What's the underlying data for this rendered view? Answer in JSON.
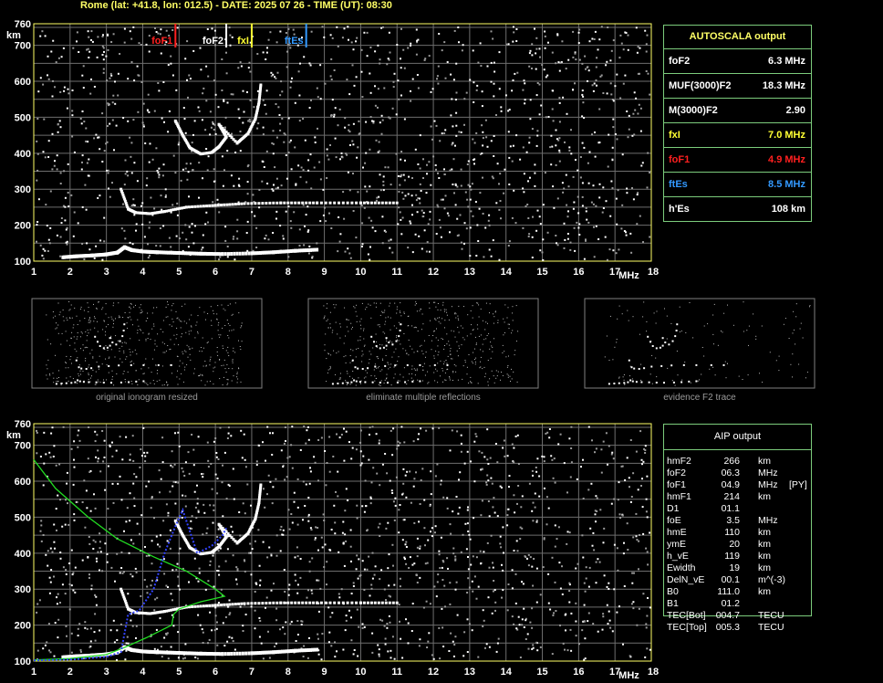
{
  "header": {
    "title": "Rome (lat: +41.8, lon: 012.5) - DATE: 2025 07 26 - TIME (UT): 08:30"
  },
  "axis": {
    "x_unit": "MHz",
    "y_unit": "km",
    "x_ticks": [
      "1",
      "2",
      "3",
      "4",
      "5",
      "6",
      "7",
      "8",
      "9",
      "10",
      "11",
      "12",
      "13",
      "14",
      "15",
      "16",
      "17",
      "18"
    ],
    "y_ticks": [
      "100",
      "200",
      "300",
      "400",
      "500",
      "600",
      "700",
      "760"
    ]
  },
  "markers": [
    {
      "label": "foF1",
      "freq": 4.9,
      "color": "#ff2020"
    },
    {
      "label": "foF2",
      "freq": 6.3,
      "color": "#ffffff"
    },
    {
      "label": "fxI",
      "freq": 7.0,
      "color": "#ffff33"
    },
    {
      "label": "ftEs",
      "freq": 8.5,
      "color": "#3399ff"
    }
  ],
  "autoscala": {
    "title": "AUTOSCALA output",
    "rows": [
      {
        "label": "foF2",
        "value": "6.3 MHz",
        "color": "#ffffff"
      },
      {
        "label": "MUF(3000)F2",
        "value": "18.3 MHz",
        "color": "#ffffff"
      },
      {
        "label": "M(3000)F2",
        "value": "2.90",
        "color": "#ffffff"
      },
      {
        "label": "fxI",
        "value": "7.0 MHz",
        "color": "#ffff33"
      },
      {
        "label": "foF1",
        "value": "4.9 MHz",
        "color": "#ff2020"
      },
      {
        "label": "ftEs",
        "value": "8.5 MHz",
        "color": "#3399ff"
      },
      {
        "label": "h'Es",
        "value": "108    km",
        "color": "#ffffff"
      }
    ]
  },
  "thumbnails": [
    {
      "caption": "original ionogram resized"
    },
    {
      "caption": "eliminate multiple reflections"
    },
    {
      "caption": "evidence F2 trace"
    }
  ],
  "aip": {
    "title": "AIP output",
    "rows": [
      {
        "name": "hmF2",
        "value": "266",
        "unit": "km",
        "note": ""
      },
      {
        "name": "foF2",
        "value": "06.3",
        "unit": "MHz",
        "note": ""
      },
      {
        "name": "foF1",
        "value": "04.9",
        "unit": "MHz",
        "note": "[PY]"
      },
      {
        "name": "hmF1",
        "value": "214",
        "unit": "km",
        "note": ""
      },
      {
        "name": "D1",
        "value": "01.1",
        "unit": "",
        "note": ""
      },
      {
        "name": "foE",
        "value": "3.5",
        "unit": "MHz",
        "note": ""
      },
      {
        "name": "hmE",
        "value": "110",
        "unit": "km",
        "note": ""
      },
      {
        "name": "ymE",
        "value": "20",
        "unit": "km",
        "note": ""
      },
      {
        "name": "h_vE",
        "value": "119",
        "unit": "km",
        "note": ""
      },
      {
        "name": "Ewidth",
        "value": "19",
        "unit": "km",
        "note": ""
      },
      {
        "name": "DelN_vE",
        "value": "00.1",
        "unit": "m^(-3)",
        "note": ""
      },
      {
        "name": "B0",
        "value": "111.0",
        "unit": "km",
        "note": ""
      },
      {
        "name": "B1",
        "value": "01.2",
        "unit": "",
        "note": ""
      },
      {
        "name": "TEC[Bot]",
        "value": "004.7",
        "unit": "TECU",
        "note": ""
      },
      {
        "name": "TEC[Top]",
        "value": "005.3",
        "unit": "TECU",
        "note": ""
      }
    ]
  },
  "chart_data": [
    {
      "type": "scatter",
      "xlim": [
        1,
        18
      ],
      "ylim": [
        100,
        760
      ],
      "grid": true,
      "series": [
        {
          "values": [
            [
              1.8,
              112
            ],
            [
              2.2,
              115
            ],
            [
              2.6,
              117
            ],
            [
              3.0,
              120
            ],
            [
              3.3,
              125
            ],
            [
              3.5,
              140
            ],
            [
              3.7,
              132
            ],
            [
              4.0,
              128
            ],
            [
              4.4,
              126
            ],
            [
              5.0,
              124
            ],
            [
              5.6,
              122
            ],
            [
              6.2,
              121
            ],
            [
              7.0,
              123
            ],
            [
              7.6,
              126
            ],
            [
              8.2,
              130
            ],
            [
              8.8,
              133
            ]
          ]
        },
        {
          "values": [
            [
              3.4,
              300
            ],
            [
              3.6,
              245
            ],
            [
              3.8,
              235
            ],
            [
              4.2,
              232
            ],
            [
              4.6,
              238
            ],
            [
              5.2,
              250
            ],
            [
              6.0,
              255
            ],
            [
              6.8,
              260
            ],
            [
              7.8,
              262
            ],
            [
              8.8,
              262
            ],
            [
              10.0,
              262
            ],
            [
              11.0,
              262
            ]
          ]
        },
        {
          "values": [
            [
              4.9,
              490
            ],
            [
              5.1,
              450
            ],
            [
              5.3,
              415
            ],
            [
              5.6,
              398
            ],
            [
              5.9,
              402
            ],
            [
              6.1,
              418
            ],
            [
              6.3,
              445
            ],
            [
              6.1,
              480
            ],
            [
              6.6,
              428
            ],
            [
              6.9,
              455
            ],
            [
              7.1,
              495
            ],
            [
              7.2,
              540
            ],
            [
              7.25,
              590
            ]
          ]
        }
      ]
    },
    {
      "type": "line",
      "xlim": [
        1,
        18
      ],
      "ylim": [
        100,
        760
      ],
      "grid": true,
      "series": [
        {
          "values": [
            [
              1.0,
              660
            ],
            [
              1.6,
              580
            ],
            [
              2.5,
              500
            ],
            [
              3.3,
              440
            ],
            [
              4.3,
              390
            ],
            [
              5.2,
              350
            ],
            [
              6.0,
              300
            ],
            [
              6.25,
              280
            ],
            [
              5.6,
              265
            ],
            [
              5.0,
              245
            ],
            [
              4.85,
              230
            ],
            [
              4.8,
              200
            ],
            [
              4.1,
              165
            ],
            [
              3.5,
              138
            ],
            [
              3.0,
              118
            ],
            [
              2.0,
              107
            ],
            [
              1.0,
              103
            ]
          ]
        },
        {
          "values": [
            [
              1.0,
              102
            ],
            [
              2.0,
              104
            ],
            [
              3.0,
              112
            ],
            [
              3.4,
              125
            ],
            [
              3.6,
              230
            ],
            [
              3.9,
              240
            ],
            [
              4.3,
              300
            ],
            [
              4.6,
              400
            ],
            [
              4.9,
              475
            ],
            [
              5.1,
              520
            ],
            [
              5.5,
              400
            ],
            [
              5.9,
              420
            ],
            [
              6.2,
              450
            ],
            [
              6.3,
              470
            ]
          ]
        }
      ]
    }
  ]
}
